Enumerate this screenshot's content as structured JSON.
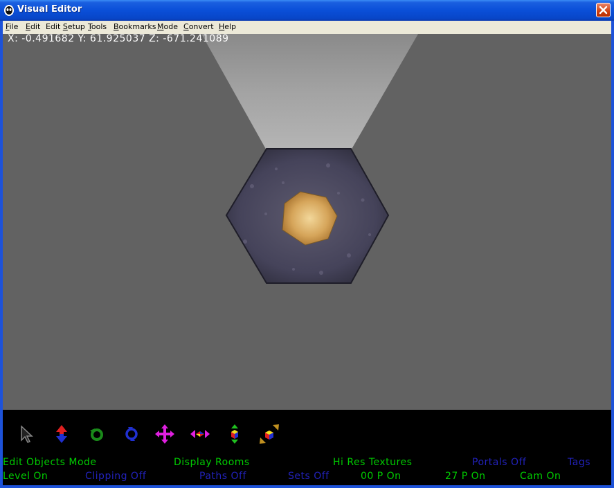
{
  "window": {
    "title": "Visual Editor",
    "close_icon": "close-icon"
  },
  "menu": [
    {
      "label": "File",
      "mnemonic": "F"
    },
    {
      "label": "Edit",
      "mnemonic": "E"
    },
    {
      "label": "Edit Setup",
      "mnemonic": "S"
    },
    {
      "label": "Tools",
      "mnemonic": "T"
    },
    {
      "label": "Bookmarks",
      "mnemonic": "B"
    },
    {
      "label": "Mode",
      "mnemonic": "M"
    },
    {
      "label": "Convert",
      "mnemonic": "C"
    },
    {
      "label": "Help",
      "mnemonic": "H"
    }
  ],
  "viewport": {
    "coordinates": "X: -0.491682 Y: 61.925037 Z: -671.241089"
  },
  "toolbar": [
    {
      "icon": "select-arrow-icon"
    },
    {
      "icon": "move-up-down-icon"
    },
    {
      "icon": "rotate-green-icon"
    },
    {
      "icon": "rotate-blue-icon"
    },
    {
      "icon": "move-four-way-icon"
    },
    {
      "icon": "move-horizontal-icon"
    },
    {
      "icon": "move-vertical-icon"
    },
    {
      "icon": "scale-diagonal-icon"
    }
  ],
  "status": {
    "row1": [
      {
        "text": "Edit Objects Mode",
        "state": "on"
      },
      {
        "text": "Display Rooms",
        "state": "on"
      },
      {
        "text": "Hi Res Textures",
        "state": "on"
      },
      {
        "text": "Portals Off",
        "state": "off"
      },
      {
        "text": "Tags",
        "state": "off"
      }
    ],
    "row2": [
      {
        "text": "Level On",
        "state": "on"
      },
      {
        "text": "Clipping Off",
        "state": "off"
      },
      {
        "text": "Paths Off",
        "state": "off"
      },
      {
        "text": "Sets Off",
        "state": "off"
      },
      {
        "text": "00 P On",
        "state": "on"
      },
      {
        "text": "27 P On",
        "state": "on"
      },
      {
        "text": "Cam On",
        "state": "on"
      }
    ]
  },
  "colors": {
    "status_on": "#00cc00",
    "status_off": "#2222bb",
    "viewport_bg": "#626262",
    "titlebar": "#0a4fd8"
  }
}
